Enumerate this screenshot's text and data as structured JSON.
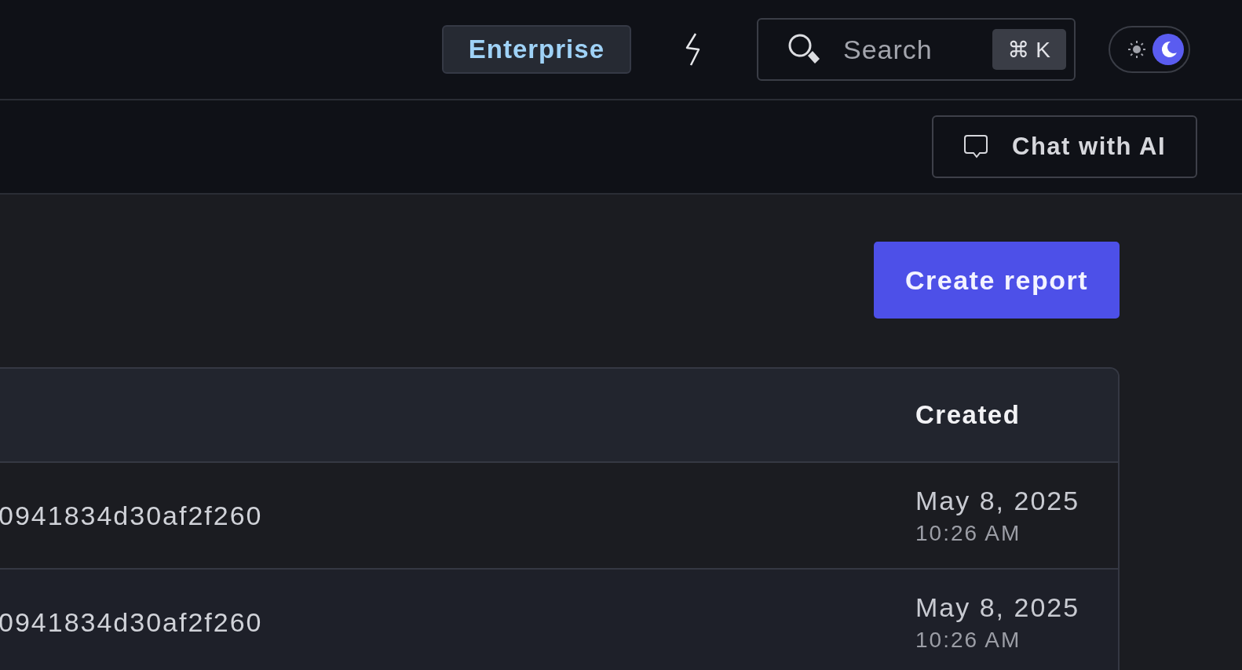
{
  "header": {
    "plan_badge": "Enterprise",
    "search": {
      "placeholder": "Search",
      "shortcut": "⌘ K"
    },
    "theme_toggle": [
      {
        "kind": "light",
        "selected": false
      },
      {
        "kind": "dark",
        "selected": true
      }
    ]
  },
  "toolbar": {
    "chat_button": "Chat with AI"
  },
  "actions": {
    "create_button": "Create report"
  },
  "table": {
    "created_heading": "Created",
    "rows": [
      {
        "column_1": "0941834d30af2f260",
        "date": "May 8, 2025",
        "time": "10:26 AM"
      },
      {
        "column_1": "0941834d30af2f260",
        "date": "May 8, 2025",
        "time": "10:26 AM"
      }
    ]
  }
}
